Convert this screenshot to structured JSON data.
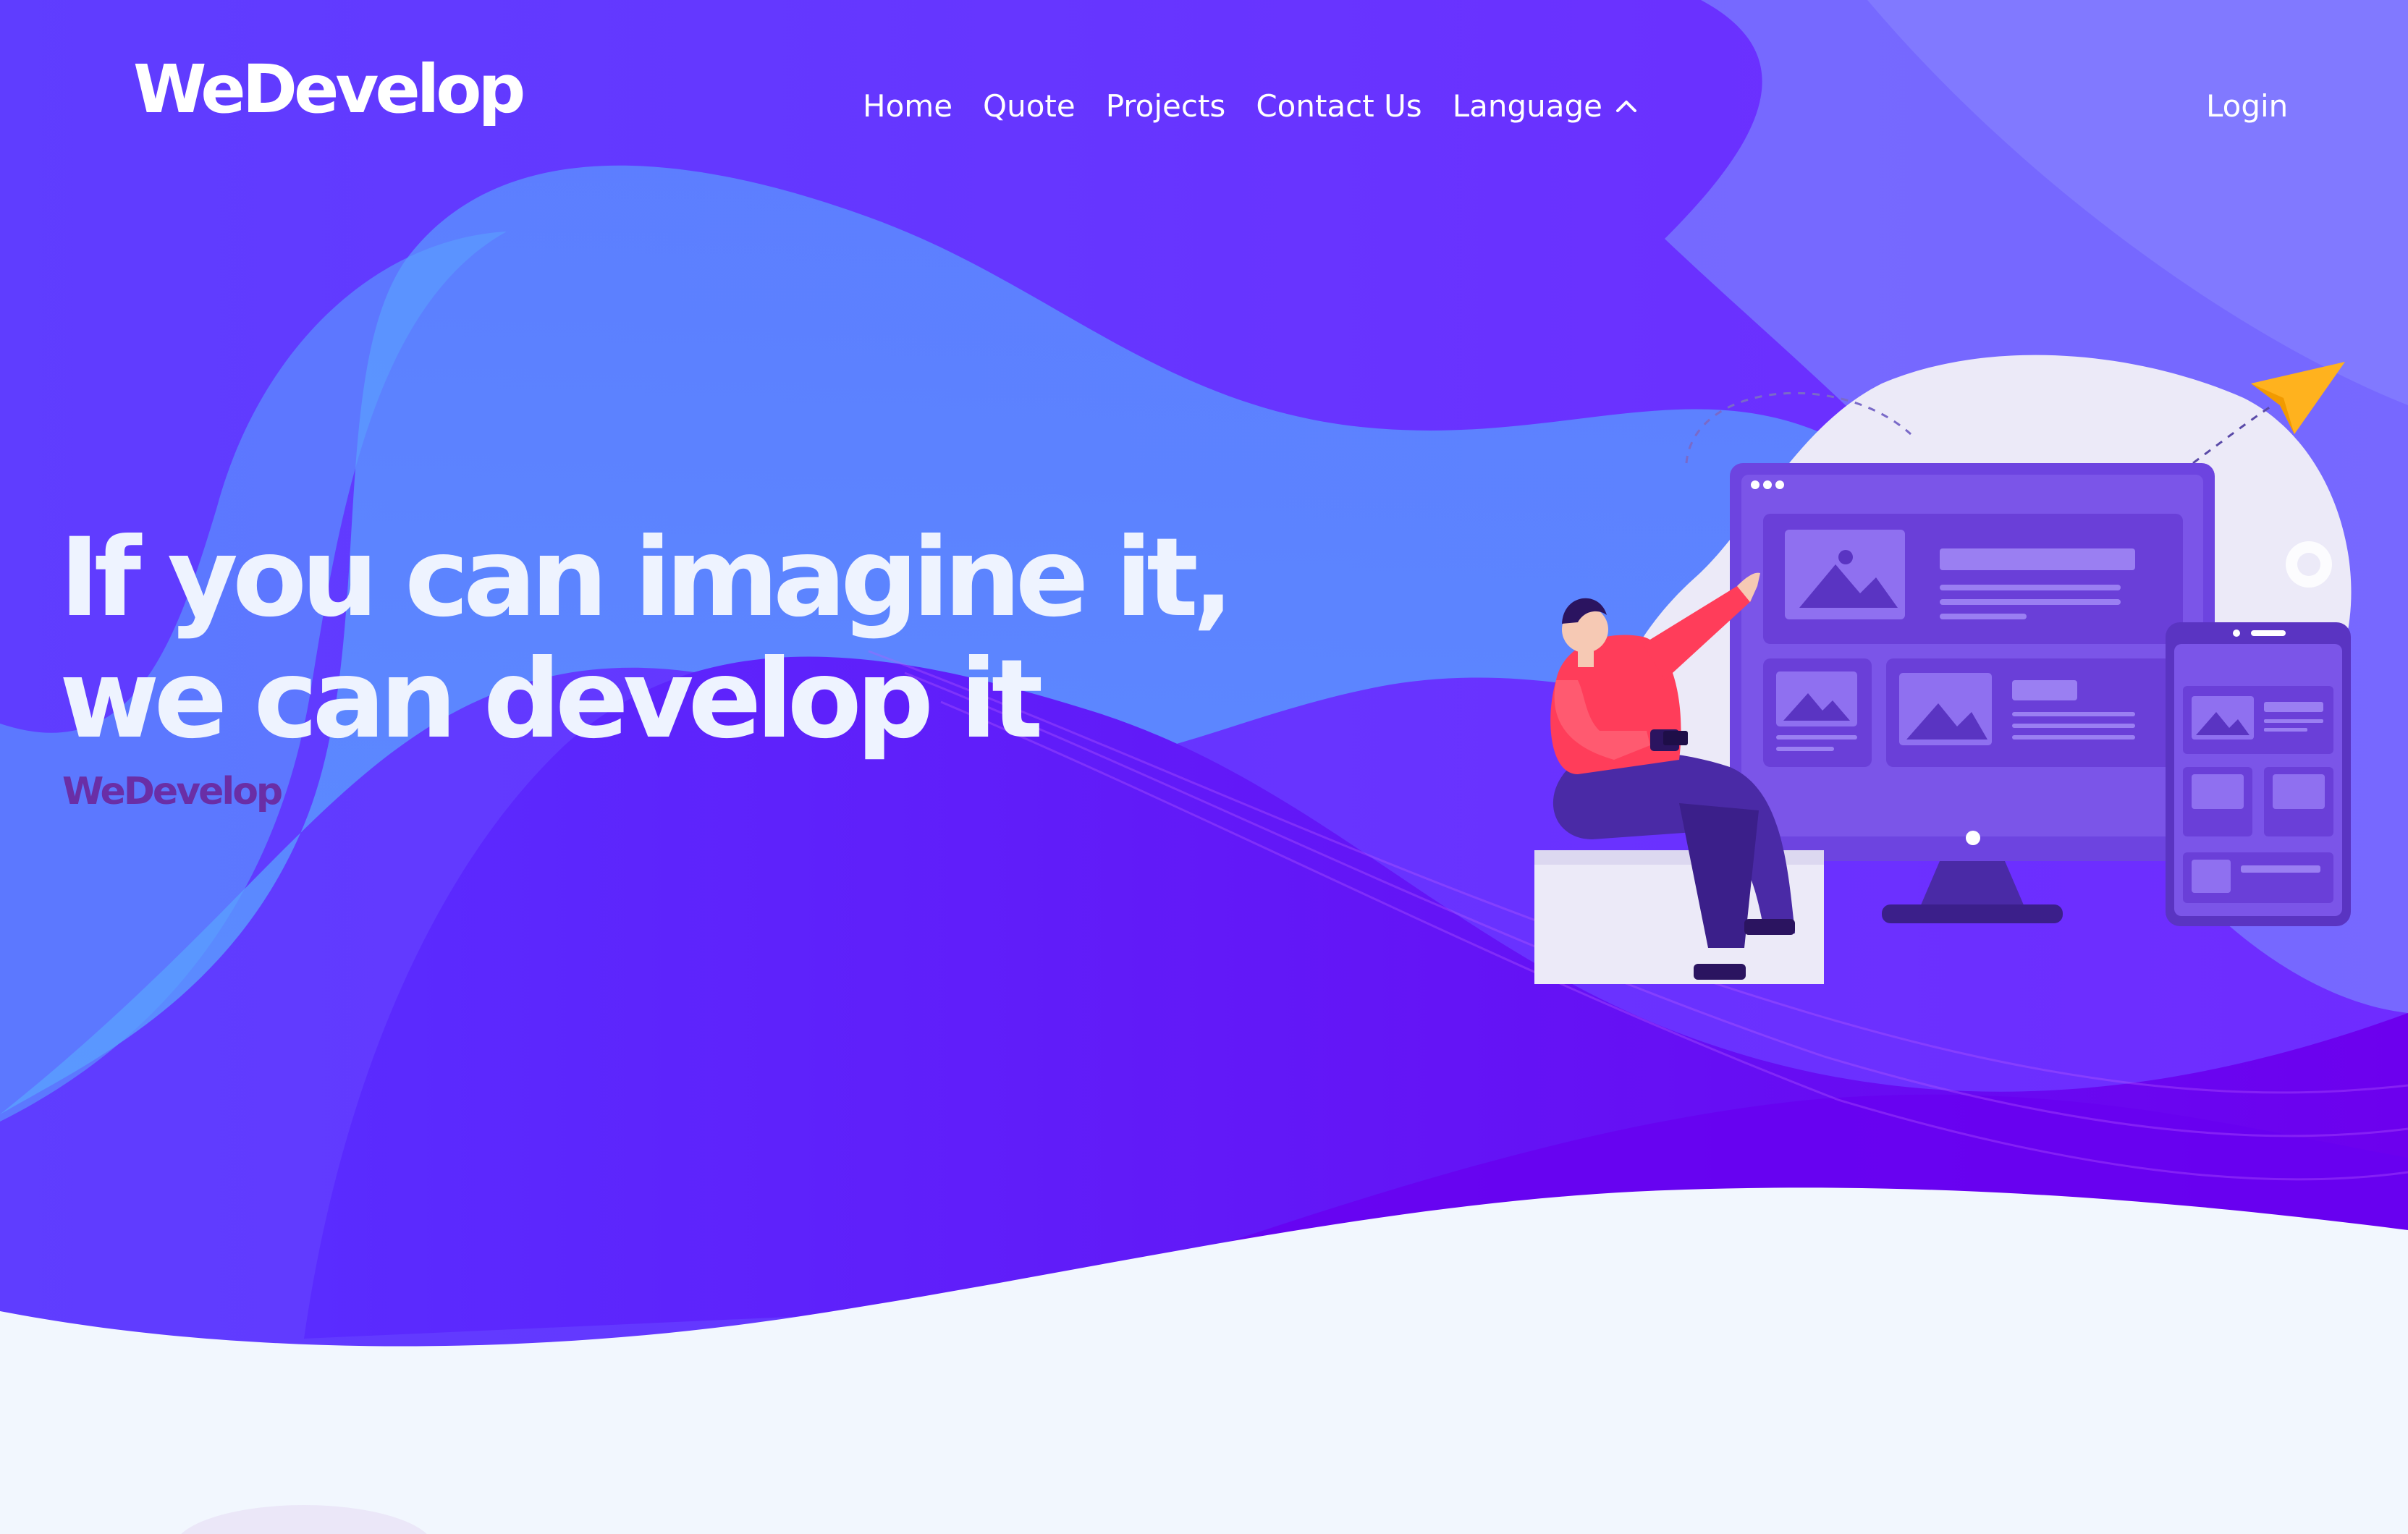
{
  "header": {
    "logo": "WeDevelop",
    "nav": {
      "home": "Home",
      "quote": "Quote",
      "projects": "Projects",
      "contact": "Contact Us",
      "language": "Language"
    },
    "login": "Login"
  },
  "hero": {
    "title": "If you can imagine it, we can develop it",
    "brand": "WeDevelop"
  },
  "colors": {
    "primary": "#5b2cff",
    "accent_blue": "#5a8cff",
    "deep_purple": "#6a00f0",
    "page_light": "#f2f7fe",
    "brand_text": "#6a2ea6",
    "figure_shirt": "#ff3d5a",
    "plane": "#ffb21e"
  },
  "icons": {
    "language_toggle": "chevron-up-icon",
    "paper_plane": "paper-plane-icon"
  }
}
